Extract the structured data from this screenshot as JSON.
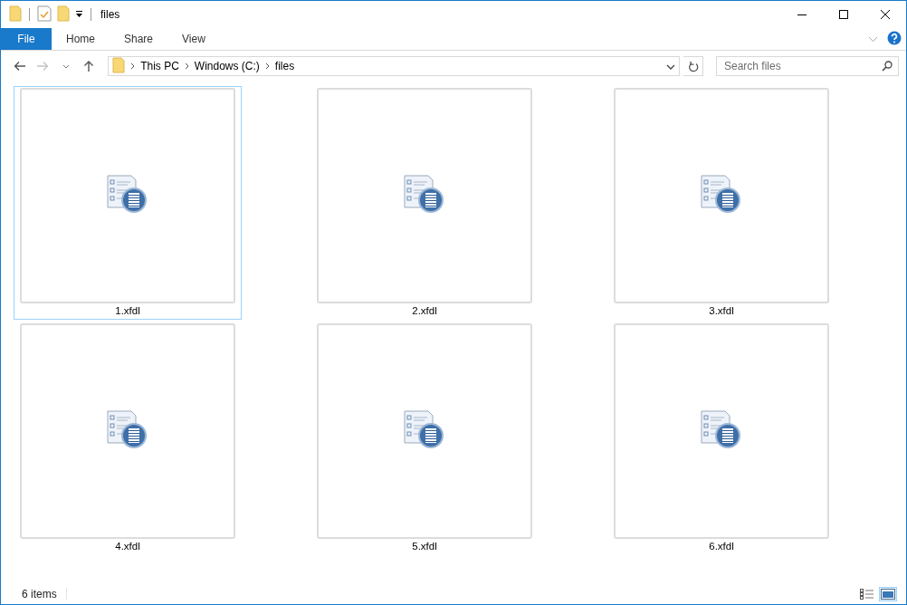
{
  "window": {
    "title": "files"
  },
  "ribbon": {
    "tabs": [
      {
        "label": "File",
        "kind": "file",
        "selected": false
      },
      {
        "label": "Home",
        "kind": "tab",
        "selected": false
      },
      {
        "label": "Share",
        "kind": "tab",
        "selected": false
      },
      {
        "label": "View",
        "kind": "tab",
        "selected": false
      }
    ]
  },
  "address_bar": {
    "path": [
      "This PC",
      "Windows (C:)",
      "files"
    ]
  },
  "search": {
    "placeholder": "Search files"
  },
  "files": [
    {
      "name": "1.xfdl",
      "selected": true
    },
    {
      "name": "2.xfdl",
      "selected": false
    },
    {
      "name": "3.xfdl",
      "selected": false
    },
    {
      "name": "4.xfdl",
      "selected": false
    },
    {
      "name": "5.xfdl",
      "selected": false
    },
    {
      "name": "6.xfdl",
      "selected": false
    }
  ],
  "status_bar": {
    "count": "6 items",
    "views": [
      {
        "kind": "details",
        "selected": false
      },
      {
        "kind": "large",
        "selected": true
      }
    ]
  }
}
